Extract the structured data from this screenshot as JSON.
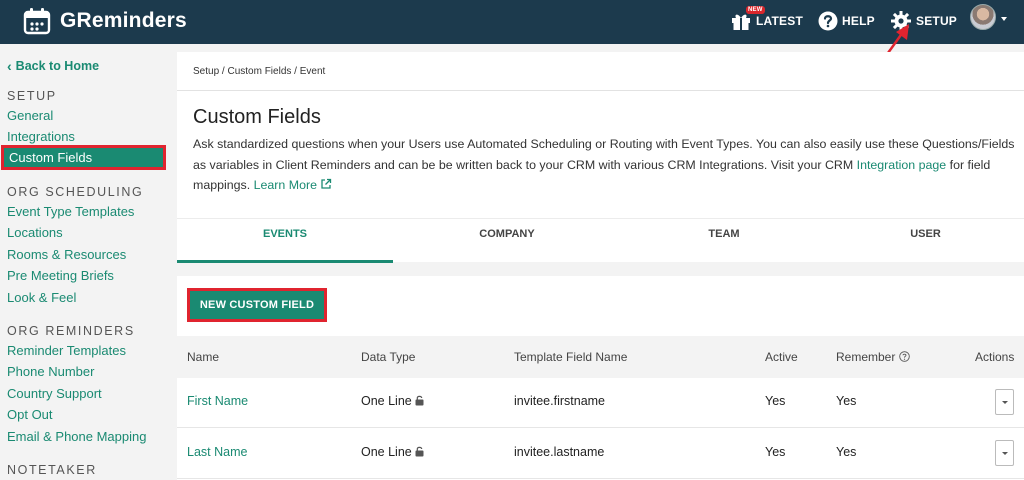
{
  "app": {
    "name": "GReminders"
  },
  "topnav": {
    "latest": "LATEST",
    "new_badge": "NEW",
    "help": "HELP",
    "setup": "SETUP"
  },
  "sidebar": {
    "back": "Back to Home",
    "sections": [
      {
        "heading": "SETUP",
        "items": [
          "General",
          "Integrations",
          "Custom Fields"
        ]
      },
      {
        "heading": "ORG SCHEDULING",
        "items": [
          "Event Type Templates",
          "Locations",
          "Rooms & Resources",
          "Pre Meeting Briefs",
          "Look & Feel"
        ]
      },
      {
        "heading": "ORG REMINDERS",
        "items": [
          "Reminder Templates",
          "Phone Number",
          "Country Support",
          "Opt Out",
          "Email & Phone Mapping"
        ]
      },
      {
        "heading": "NOTETAKER",
        "items": []
      }
    ],
    "active_item": "Custom Fields"
  },
  "breadcrumb": "Setup / Custom Fields / Event",
  "page": {
    "title": "Custom Fields",
    "desc_part1": "Ask standardized questions when your Users use Automated Scheduling or Routing with Event Types. You can also easily use these Questions/Fields as variables in Client Reminders and can be be written back to your CRM with various CRM Integrations. Visit your CRM ",
    "desc_link1": "Integration page",
    "desc_part2": " for field mappings. ",
    "desc_link2": "Learn More"
  },
  "tabs": [
    "EVENTS",
    "COMPANY",
    "TEAM",
    "USER"
  ],
  "active_tab": "EVENTS",
  "new_button": "NEW CUSTOM FIELD",
  "table": {
    "columns": [
      "Name",
      "Data Type",
      "Template Field Name",
      "Active",
      "Remember",
      "Actions"
    ],
    "rows": [
      {
        "name": "First Name",
        "data_type": "One Line",
        "template": "invitee.firstname",
        "active": "Yes",
        "remember": "Yes"
      },
      {
        "name": "Last Name",
        "data_type": "One Line",
        "template": "invitee.lastname",
        "active": "Yes",
        "remember": "Yes"
      }
    ]
  },
  "colors": {
    "topbar": "#1c3a4d",
    "accent": "#1a8a72",
    "highlight": "#e0242f"
  }
}
